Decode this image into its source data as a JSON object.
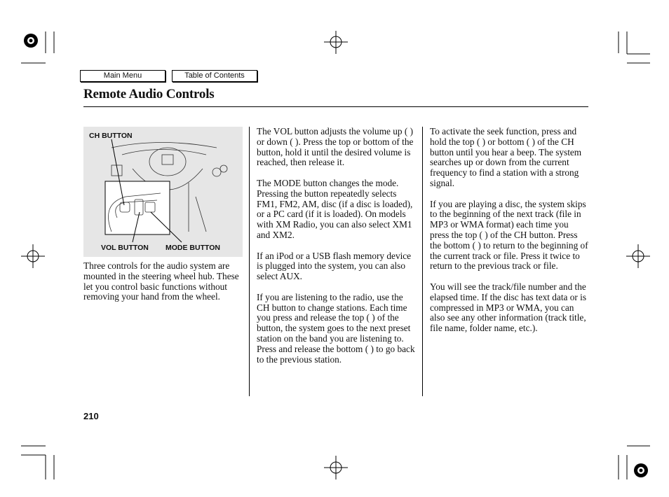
{
  "nav": {
    "main_menu": "Main Menu",
    "toc": "Table of Contents"
  },
  "title": "Remote Audio Controls",
  "figure": {
    "ch_label": "CH BUTTON",
    "vol_label": "VOL BUTTON",
    "mode_label": "MODE BUTTON"
  },
  "col1": [
    "Three controls for the audio system are mounted in the steering wheel hub. These let you control basic functions without removing your hand from the wheel."
  ],
  "col2": [
    "The VOL button adjusts the volume up (   ) or down (   ). Press the top or bottom of the button, hold it until the desired volume is reached, then release it.",
    "The MODE button changes the mode. Pressing the button repeatedly selects FM1, FM2, AM, disc (if a disc is loaded), or a PC card (if it is loaded). On models with XM Radio, you can also select XM1 and XM2.",
    "If an iPod or a USB flash memory device is plugged into the system, you can also select AUX.",
    "If you are listening to the radio, use the CH button to change stations. Each time you press and release the top (   ) of the button, the system goes to the next preset station on the band you are listening to. Press and release the bottom (   ) to go back to the previous station."
  ],
  "col3": [
    "To activate the seek function, press and hold the top (   ) or bottom (   ) of the CH button until you hear a beep. The system searches up or down from the current frequency to find a station with a strong signal.",
    "If you are playing a disc, the system skips to the beginning of the next track (file in MP3 or WMA format) each time you press the top (   ) of the CH button. Press the bottom (   ) to return to the beginning of the current track or file. Press it twice to return to the previous track or file.",
    "You will see the track/file number and the elapsed time. If the disc has text data or is compressed in MP3 or WMA, you can also see any other information (track title, file name, folder name, etc.)."
  ],
  "page_number": "210"
}
